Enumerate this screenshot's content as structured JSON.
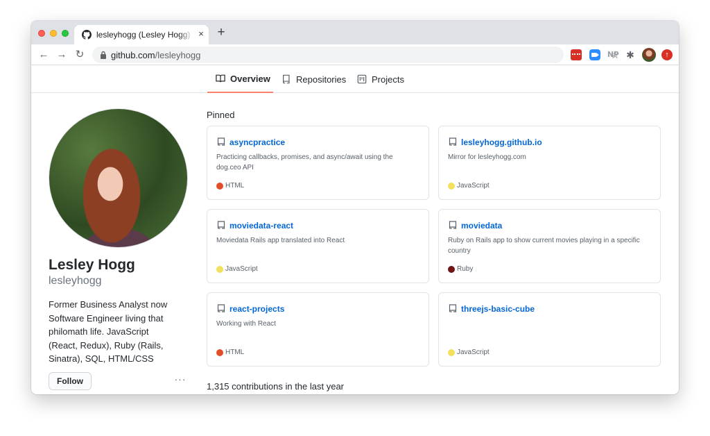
{
  "browser": {
    "tab_title": "lesleyhogg (Lesley Hogg) · GitHub",
    "tab_close": "×",
    "new_tab": "+",
    "url_host": "github.com",
    "url_path": "/lesleyhogg",
    "ext_np": "NP"
  },
  "profile_nav": {
    "overview": "Overview",
    "repositories": "Repositories",
    "projects": "Projects"
  },
  "profile": {
    "name": "Lesley Hogg",
    "login": "lesleyhogg",
    "bio": "Former Business Analyst now Software Engineer living that philomath life. JavaScript (React, Redux), Ruby (Rails, Sinatra), SQL, HTML/CSS",
    "follow_label": "Follow",
    "more_label": "···"
  },
  "pinned": {
    "title": "Pinned",
    "repos": [
      {
        "name": "asyncpractice",
        "description": "Practicing callbacks, promises, and async/await using the dog.ceo API",
        "language": "HTML",
        "color": "#e34c26"
      },
      {
        "name": "lesleyhogg.github.io",
        "description": "Mirror for lesleyhogg.com",
        "language": "JavaScript",
        "color": "#f1e05a"
      },
      {
        "name": "moviedata-react",
        "description": "Moviedata Rails app translated into React",
        "language": "JavaScript",
        "color": "#f1e05a"
      },
      {
        "name": "moviedata",
        "description": "Ruby on Rails app to show current movies playing in a specific country",
        "language": "Ruby",
        "color": "#701516"
      },
      {
        "name": "react-projects",
        "description": "Working with React",
        "language": "HTML",
        "color": "#e34c26"
      },
      {
        "name": "threejs-basic-cube",
        "description": "",
        "language": "JavaScript",
        "color": "#f1e05a"
      }
    ]
  },
  "contributions": "1,315 contributions in the last year",
  "colors": {
    "link": "#0366d6",
    "tab_underline": "#f9826c"
  }
}
